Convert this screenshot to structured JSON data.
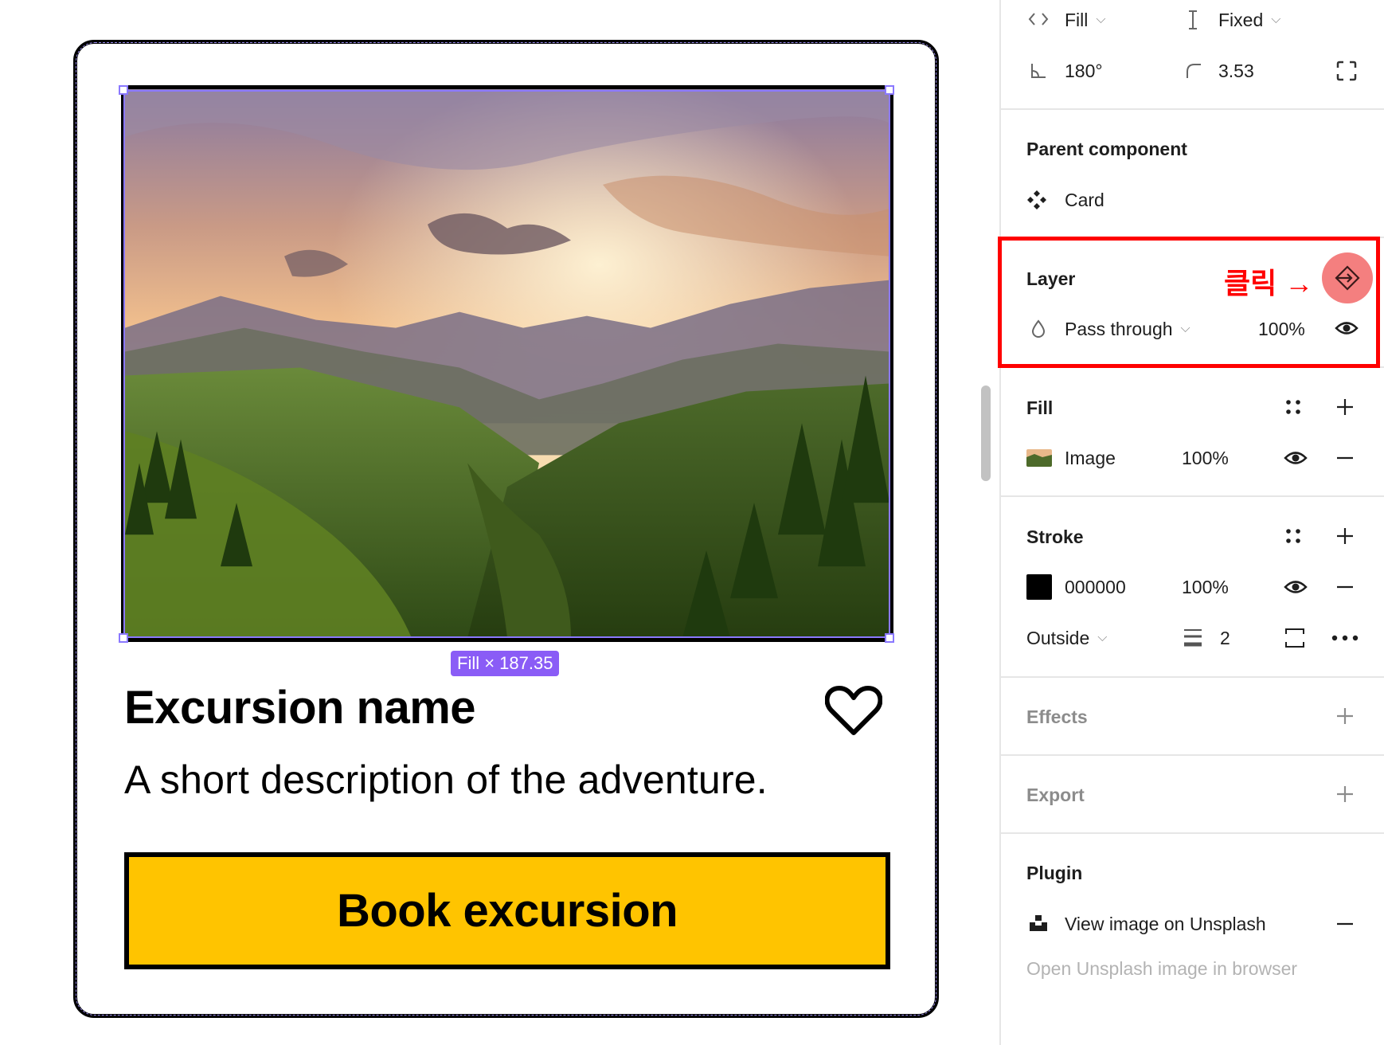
{
  "canvas": {
    "selection_badge": "Fill × 187.35",
    "card": {
      "title": "Excursion name",
      "description": "A short description of the adventure.",
      "button_label": "Book excursion",
      "button_color": "#FFC400",
      "image_icon": "mountain-valley-photo",
      "favorite_icon": "heart-outline-icon"
    }
  },
  "panel": {
    "sizing": {
      "width_mode": "Fill",
      "height_mode": "Fixed",
      "rotation": "180°",
      "corner_radius": "3.53"
    },
    "parent_component": {
      "title": "Parent component",
      "name": "Card"
    },
    "layer": {
      "title": "Layer",
      "blend_mode": "Pass through",
      "opacity": "100%",
      "annotation": "클릭 →"
    },
    "fill": {
      "title": "Fill",
      "type": "Image",
      "opacity": "100%"
    },
    "stroke": {
      "title": "Stroke",
      "color_hex": "000000",
      "color": "#000000",
      "opacity": "100%",
      "position": "Outside",
      "weight": "2"
    },
    "effects": {
      "title": "Effects"
    },
    "export": {
      "title": "Export"
    },
    "plugin": {
      "title": "Plugin",
      "item": "View image on Unsplash",
      "hint": "Open Unsplash image in browser"
    }
  },
  "colors": {
    "selection": "#8A78FF",
    "badge": "#8A5CF6",
    "annotation_red": "#FF0000",
    "highlight_button": "#F47F7F"
  }
}
